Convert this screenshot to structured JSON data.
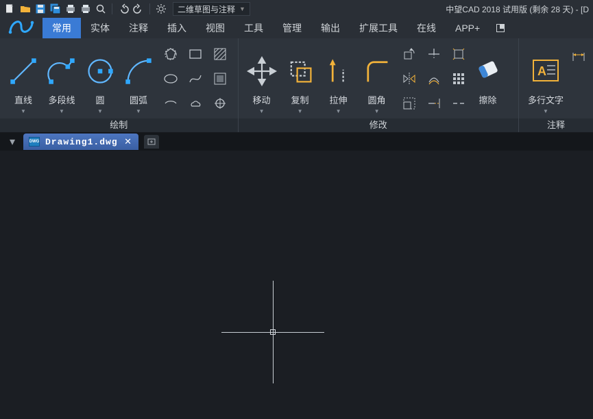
{
  "app": {
    "title": "中望CAD 2018 试用版 (剩余 28 天) - [D",
    "workspace": "二维草图与注释"
  },
  "menu": {
    "tabs": {
      "common": "常用",
      "solid": "实体",
      "annotate": "注释",
      "insert": "插入",
      "view": "视图",
      "tools": "工具",
      "manage": "管理",
      "output": "输出",
      "ext": "扩展工具",
      "online": "在线",
      "appplus": "APP+"
    }
  },
  "ribbon": {
    "draw": {
      "panel_label": "绘制",
      "line": "直线",
      "polyline": "多段线",
      "circle": "圆",
      "arc": "圆弧"
    },
    "modify": {
      "panel_label": "修改",
      "move": "移动",
      "copy": "复制",
      "stretch": "拉伸",
      "fillet": "圆角",
      "erase": "擦除"
    },
    "annotate": {
      "panel_label": "注释",
      "mtext": "多行文字"
    }
  },
  "filetab": {
    "name": "Drawing1.dwg"
  }
}
